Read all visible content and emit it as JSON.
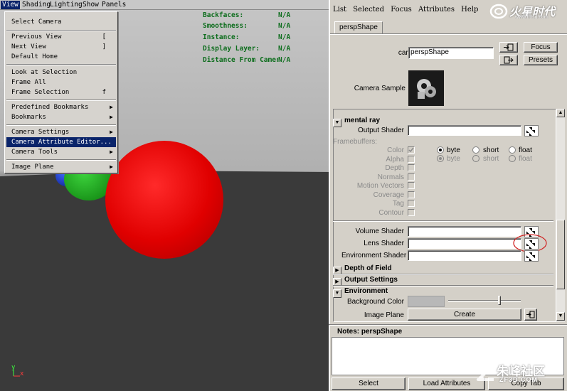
{
  "viewport": {
    "menubar": [
      "View",
      "Shading",
      "Lighting",
      "Show",
      "Panels"
    ],
    "hud": [
      {
        "label": "Backfaces:",
        "value": "N/A"
      },
      {
        "label": "Smoothness:",
        "value": "N/A"
      },
      {
        "label": "Instance:",
        "value": "N/A"
      },
      {
        "label": "Display Layer:",
        "value": "N/A"
      },
      {
        "label": "Distance From Camera:",
        "value": "N/A"
      }
    ],
    "axis": {
      "y": "y",
      "x": "x"
    },
    "colors": {
      "red_sphere": "#e00000",
      "green_sphere": "#1cae1c",
      "blue_sphere": "#1c3ad8",
      "hud_text": "#0c6d1c"
    }
  },
  "view_menu": {
    "items": [
      {
        "label": "Select Camera",
        "shortcut": "",
        "submenu": false
      },
      {
        "label": "Previous View",
        "shortcut": "[",
        "submenu": false
      },
      {
        "label": "Next View",
        "shortcut": "]",
        "submenu": false
      },
      {
        "label": "Default Home",
        "shortcut": "",
        "submenu": false
      },
      {
        "label": "Look at Selection",
        "shortcut": "",
        "submenu": false
      },
      {
        "label": "Frame All",
        "shortcut": "",
        "submenu": false
      },
      {
        "label": "Frame Selection",
        "shortcut": "f",
        "submenu": false
      },
      {
        "label": "Predefined Bookmarks",
        "shortcut": "",
        "submenu": true
      },
      {
        "label": "Bookmarks",
        "shortcut": "",
        "submenu": true
      },
      {
        "label": "Camera Settings",
        "shortcut": "",
        "submenu": true
      },
      {
        "label": "Camera Attribute Editor...",
        "shortcut": "",
        "submenu": false,
        "highlighted": true
      },
      {
        "label": "Camera Tools",
        "shortcut": "",
        "submenu": true
      },
      {
        "label": "Image Plane",
        "shortcut": "",
        "submenu": true
      }
    ]
  },
  "attribute_editor": {
    "menubar": [
      "List",
      "Selected",
      "Focus",
      "Attributes",
      "Help"
    ],
    "watermark_top": "火星时代",
    "watermark_top_sub": "www.hxsd.com",
    "tab": "perspShape",
    "camera_label": "camera:",
    "camera_value": "perspShape",
    "focus_button": "Focus",
    "presets_button": "Presets",
    "camera_sample_label": "Camera Sample",
    "mental_ray": {
      "title": "mental ray",
      "output_shader_label": "Output Shader",
      "framebuffers_label": "Framebuffers:",
      "buffers": [
        {
          "label": "Color",
          "checked": true,
          "enabled": true
        },
        {
          "label": "Alpha",
          "checked": false,
          "enabled": false
        },
        {
          "label": "Depth",
          "checked": false,
          "enabled": false
        },
        {
          "label": "Normals",
          "checked": false,
          "enabled": false
        },
        {
          "label": "Motion Vectors",
          "checked": false,
          "enabled": false
        },
        {
          "label": "Coverage",
          "checked": false,
          "enabled": false
        },
        {
          "label": "Tag",
          "checked": false,
          "enabled": false
        },
        {
          "label": "Contour",
          "checked": false,
          "enabled": false
        }
      ],
      "type_options_row1": [
        "byte",
        "short",
        "float"
      ],
      "type_options_row2": [
        "byte",
        "short",
        "float"
      ],
      "volume_shader_label": "Volume Shader",
      "lens_shader_label": "Lens Shader",
      "environment_shader_label": "Environment Shader"
    },
    "sections": [
      {
        "title": "Depth of Field",
        "expanded": false
      },
      {
        "title": "Output Settings",
        "expanded": false
      },
      {
        "title": "Environment",
        "expanded": true
      }
    ],
    "environment": {
      "background_color_label": "Background Color",
      "background_color": "#b8b8b8",
      "image_plane_label": "Image Plane",
      "create_button": "Create"
    },
    "notes_label": "Notes: perspShape",
    "bottom_buttons": [
      "Select",
      "Load Attributes",
      "Copy Tab"
    ],
    "watermark_bottom": "朱峰社区",
    "watermark_bottom_sub": "ZF3D.COM",
    "annotation_color": "#d02020"
  }
}
